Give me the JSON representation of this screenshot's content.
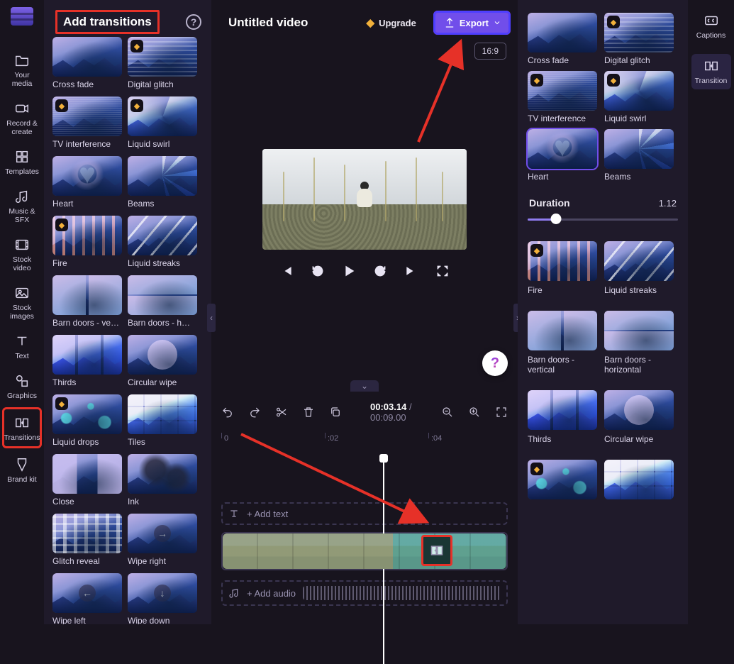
{
  "leftnav": {
    "items": [
      {
        "icon": "folder",
        "label": "Your media"
      },
      {
        "icon": "record",
        "label": "Record & create"
      },
      {
        "icon": "templates",
        "label": "Templates"
      },
      {
        "icon": "music",
        "label": "Music & SFX"
      },
      {
        "icon": "stockvideo",
        "label": "Stock video"
      },
      {
        "icon": "stockimages",
        "label": "Stock images"
      },
      {
        "icon": "text",
        "label": "Text"
      },
      {
        "icon": "graphics",
        "label": "Graphics"
      },
      {
        "icon": "transitions",
        "label": "Transitions",
        "active": true,
        "highlight": true
      },
      {
        "icon": "brandkit",
        "label": "Brand kit"
      }
    ]
  },
  "panel2": {
    "title": "Add transitions",
    "items": [
      {
        "label": "Cross fade",
        "premium": false,
        "ov": ""
      },
      {
        "label": "Digital glitch",
        "premium": true,
        "ov": "glitch"
      },
      {
        "label": "TV interference",
        "premium": true,
        "ov": "interf"
      },
      {
        "label": "Liquid swirl",
        "premium": true,
        "ov": "swirl"
      },
      {
        "label": "Heart",
        "premium": false,
        "ov": "heart"
      },
      {
        "label": "Beams",
        "premium": false,
        "ov": "beams"
      },
      {
        "label": "Fire",
        "premium": true,
        "ov": "fire"
      },
      {
        "label": "Liquid streaks",
        "premium": false,
        "ov": "streaks"
      },
      {
        "label": "Barn doors - ve…",
        "premium": false,
        "ov": "barn-v"
      },
      {
        "label": "Barn doors - h…",
        "premium": false,
        "ov": "barn-h"
      },
      {
        "label": "Thirds",
        "premium": false,
        "ov": "thirds"
      },
      {
        "label": "Circular wipe",
        "premium": false,
        "ov": "circ"
      },
      {
        "label": "Liquid drops",
        "premium": true,
        "ov": "drops"
      },
      {
        "label": "Tiles",
        "premium": false,
        "ov": "tiles"
      },
      {
        "label": "Close",
        "premium": false,
        "ov": "close"
      },
      {
        "label": "Ink",
        "premium": false,
        "ov": "ink"
      },
      {
        "label": "Glitch reveal",
        "premium": false,
        "ov": "glitchreveal"
      },
      {
        "label": "Wipe right",
        "premium": false,
        "ov": "arrow right"
      },
      {
        "label": "Wipe left",
        "premium": false,
        "ov": "arrow left"
      },
      {
        "label": "Wipe down",
        "premium": false,
        "ov": "arrow down"
      }
    ]
  },
  "header": {
    "title": "Untitled video",
    "upgrade": "Upgrade",
    "export": "Export",
    "aspect": "16:9"
  },
  "timeline": {
    "timecode_current": "00:03.14",
    "timecode_total": "00:09.00",
    "ticks": [
      "0",
      ":02",
      ":04"
    ],
    "add_text": "+ Add text",
    "add_audio": "+ Add audio"
  },
  "panel3": {
    "duration_label": "Duration",
    "duration_value": "1.12",
    "groups": {
      "a": [
        {
          "label": "Cross fade",
          "premium": false,
          "ov": ""
        },
        {
          "label": "Digital glitch",
          "premium": true,
          "ov": "glitch"
        },
        {
          "label": "TV interference",
          "premium": true,
          "ov": "interf"
        },
        {
          "label": "Liquid swirl",
          "premium": true,
          "ov": "swirl"
        },
        {
          "label": "Heart",
          "premium": false,
          "ov": "heart",
          "selected": true
        },
        {
          "label": "Beams",
          "premium": false,
          "ov": "beams"
        }
      ],
      "b": [
        {
          "label": "Fire",
          "premium": true,
          "ov": "fire"
        },
        {
          "label": "Liquid streaks",
          "premium": false,
          "ov": "streaks"
        },
        {
          "label": "Barn doors - vertical",
          "premium": false,
          "ov": "barn-v"
        },
        {
          "label": "Barn doors - horizontal",
          "premium": false,
          "ov": "barn-h"
        },
        {
          "label": "Thirds",
          "premium": false,
          "ov": "thirds"
        },
        {
          "label": "Circular wipe",
          "premium": false,
          "ov": "circ"
        },
        {
          "label": "",
          "premium": true,
          "ov": "drops"
        },
        {
          "label": "",
          "premium": false,
          "ov": "tiles"
        }
      ]
    }
  },
  "rightnav": {
    "items": [
      {
        "label": "Captions",
        "icon": "cc"
      },
      {
        "label": "Transition",
        "icon": "transition",
        "active": true
      }
    ]
  }
}
